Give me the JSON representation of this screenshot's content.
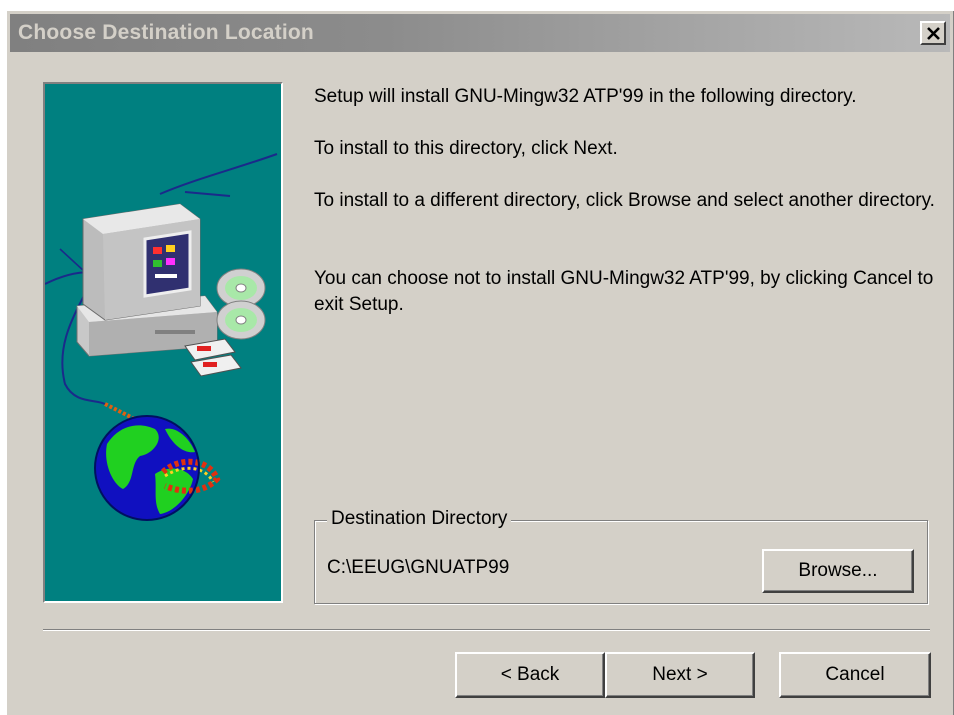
{
  "window": {
    "title": "Choose Destination Location",
    "close_icon": "close-icon"
  },
  "side_image": {
    "description_icon": "computer-globe-illustration",
    "colors": {
      "background": "#008080",
      "globe_ocean": "#1010c0",
      "globe_land": "#20d020"
    }
  },
  "message": {
    "line1": "Setup will install GNU-Mingw32 ATP'99 in the following directory.",
    "line2": "To install to this directory, click Next.",
    "line3": "To install to a different directory, click Browse and select another directory.",
    "line4": "You can choose not to install GNU-Mingw32 ATP'99, by clicking Cancel to exit Setup."
  },
  "destination": {
    "group_label": "Destination Directory",
    "path": "C:\\EEUG\\GNUATP99",
    "browse_label": "Browse..."
  },
  "buttons": {
    "back_label": "< Back",
    "next_label": "Next >",
    "cancel_label": "Cancel"
  },
  "colors": {
    "dialog_bg": "#d4d0c8",
    "title_gradient_start": "#808080",
    "title_gradient_end": "#b9b9b9",
    "title_text": "#d4d0c8"
  }
}
